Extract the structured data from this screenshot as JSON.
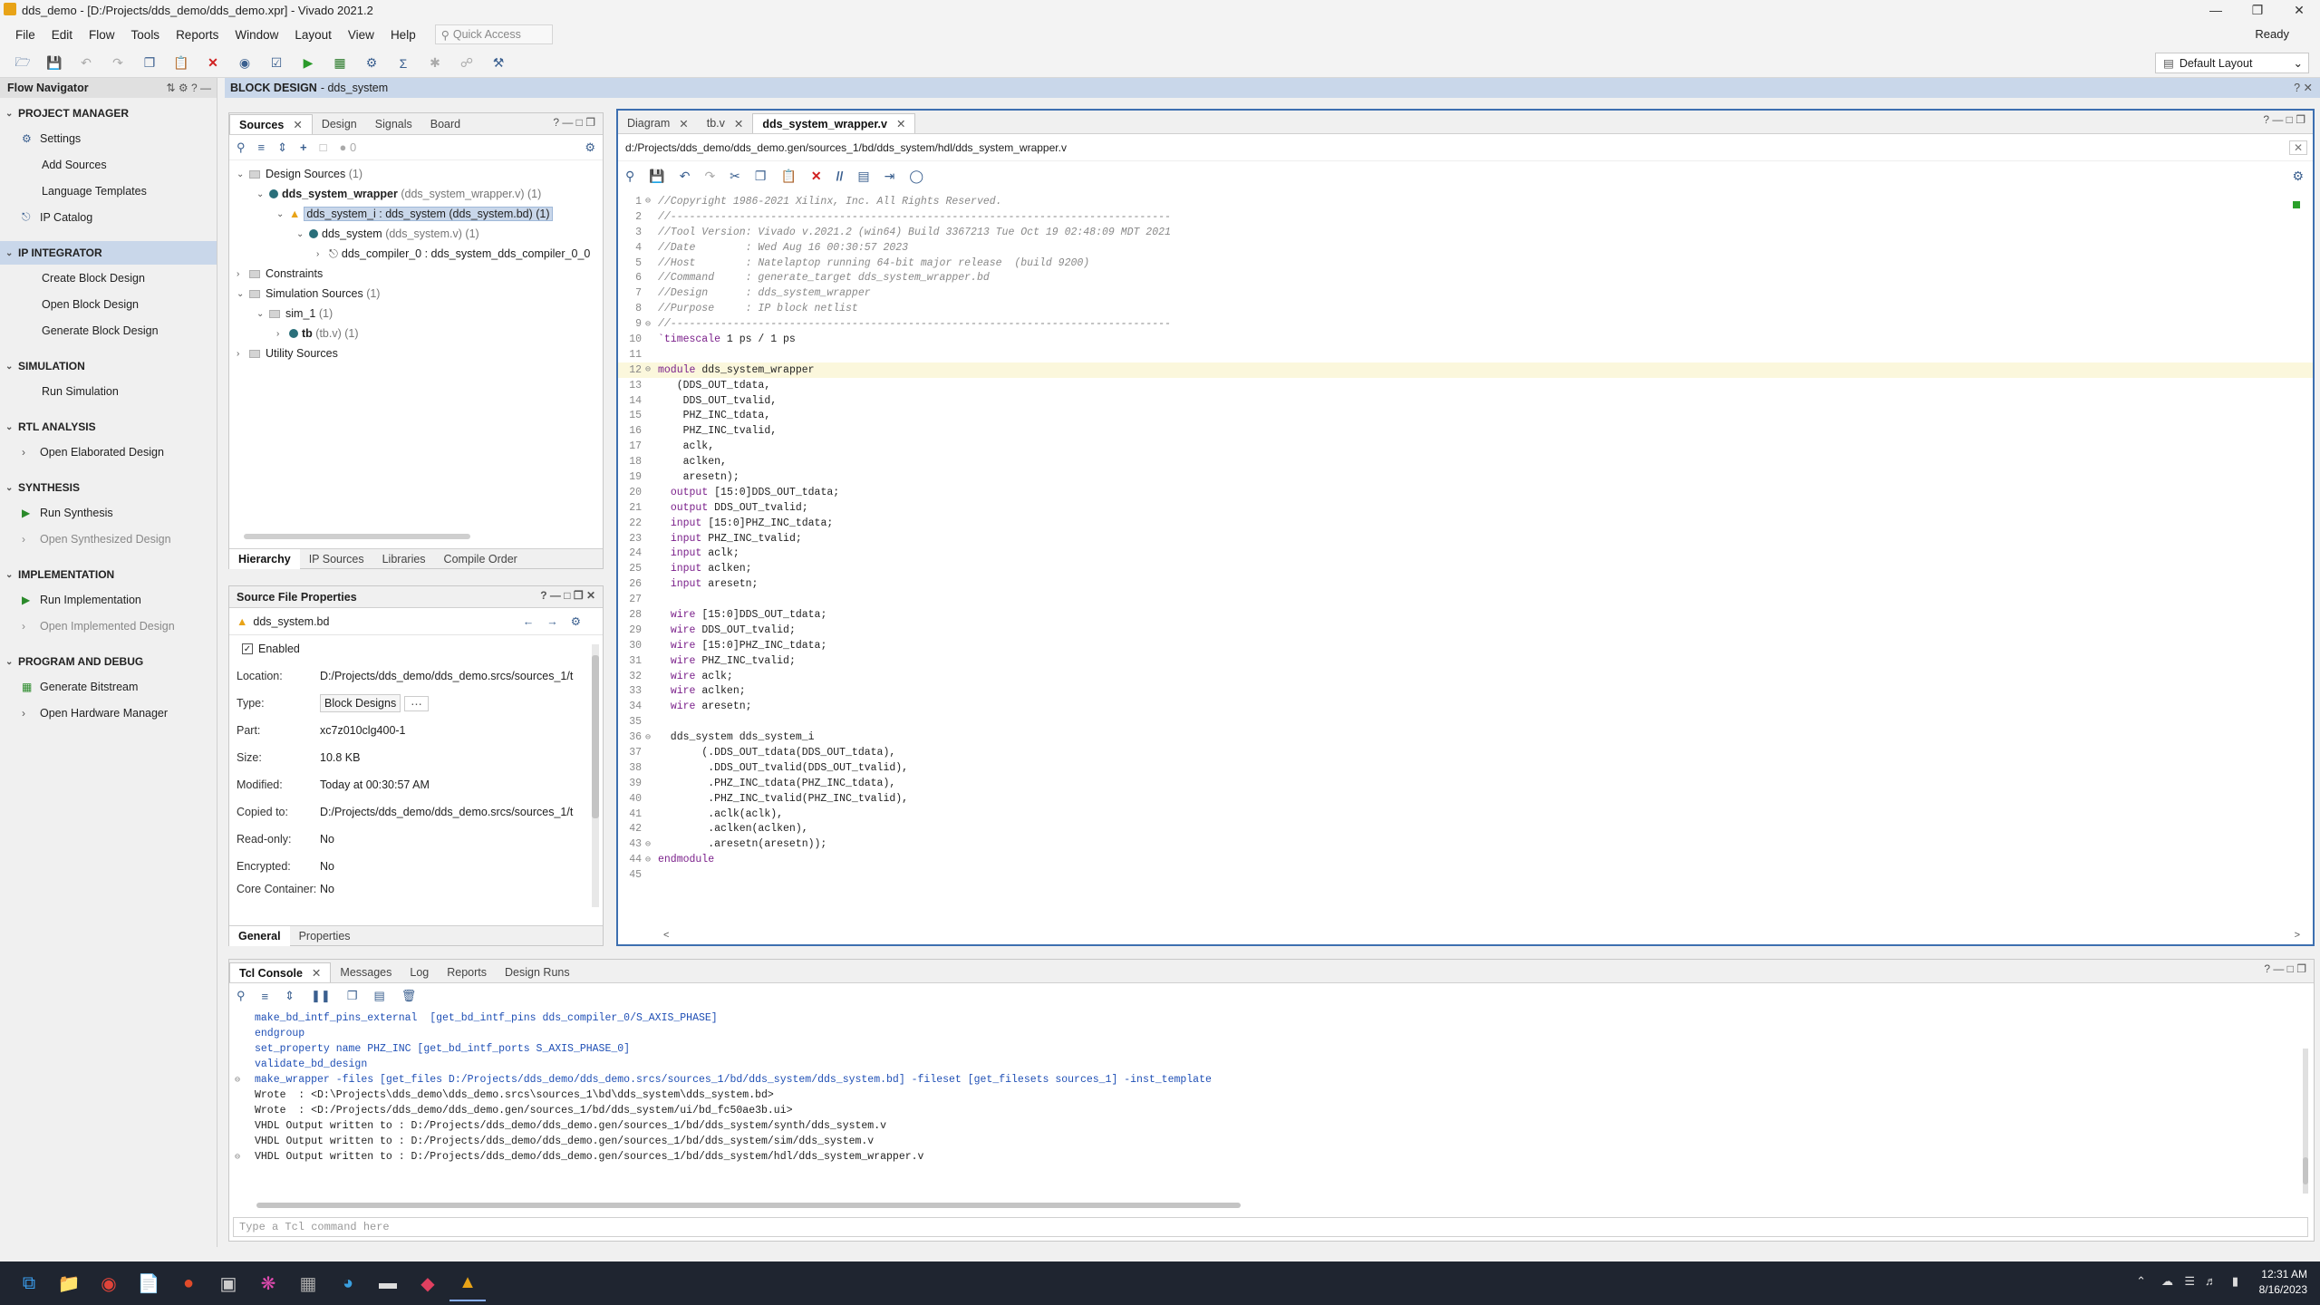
{
  "titlebar": {
    "title": "dds_demo - [D:/Projects/dds_demo/dds_demo.xpr] - Vivado 2021.2"
  },
  "menu": {
    "items": [
      "File",
      "Edit",
      "Flow",
      "Tools",
      "Reports",
      "Window",
      "Layout",
      "View",
      "Help"
    ],
    "quick_access": "Quick Access",
    "status": "Ready"
  },
  "toolbar": {
    "layout": "Default Layout"
  },
  "flownav": {
    "title": "Flow Navigator",
    "sections": [
      {
        "label": "PROJECT MANAGER",
        "items": [
          "Settings",
          "Add Sources",
          "Language Templates",
          "IP Catalog"
        ]
      },
      {
        "label": "IP INTEGRATOR",
        "items": [
          "Create Block Design",
          "Open Block Design",
          "Generate Block Design"
        ]
      },
      {
        "label": "SIMULATION",
        "items": [
          "Run Simulation"
        ]
      },
      {
        "label": "RTL ANALYSIS",
        "items": [
          "Open Elaborated Design"
        ]
      },
      {
        "label": "SYNTHESIS",
        "items": [
          "Run Synthesis",
          "Open Synthesized Design"
        ]
      },
      {
        "label": "IMPLEMENTATION",
        "items": [
          "Run Implementation",
          "Open Implemented Design"
        ]
      },
      {
        "label": "PROGRAM AND DEBUG",
        "items": [
          "Generate Bitstream",
          "Open Hardware Manager"
        ]
      }
    ]
  },
  "bd": {
    "label": "BLOCK DESIGN",
    "name": "- dds_system"
  },
  "sources": {
    "tabs": [
      "Sources",
      "Design",
      "Signals",
      "Board"
    ],
    "count": "0",
    "tree": [
      {
        "t": "Design Sources",
        "g": "(1)"
      },
      {
        "t": "dds_system_wrapper",
        "g": "(dds_system_wrapper.v) (1)"
      },
      {
        "t": "dds_system_i : dds_system (dds_system.bd) (1)",
        "g": ""
      },
      {
        "t": "dds_system",
        "g": "(dds_system.v) (1)"
      },
      {
        "t": "dds_compiler_0 : dds_system_dds_compiler_0_0",
        "g": ""
      },
      {
        "t": "Constraints",
        "g": ""
      },
      {
        "t": "Simulation Sources",
        "g": "(1)"
      },
      {
        "t": "sim_1",
        "g": "(1)"
      },
      {
        "t": "tb",
        "g": "(tb.v) (1)"
      },
      {
        "t": "Utility Sources",
        "g": ""
      }
    ],
    "bottom_tabs": [
      "Hierarchy",
      "IP Sources",
      "Libraries",
      "Compile Order"
    ]
  },
  "props": {
    "title": "Source File Properties",
    "file": "dds_system.bd",
    "enabled": "Enabled",
    "rows": [
      {
        "k": "Location:",
        "v": "D:/Projects/dds_demo/dds_demo.srcs/sources_1/t"
      },
      {
        "k": "Type:",
        "v": "Block Designs"
      },
      {
        "k": "Part:",
        "v": "xc7z010clg400-1"
      },
      {
        "k": "Size:",
        "v": "10.8 KB"
      },
      {
        "k": "Modified:",
        "v": "Today at 00:30:57 AM"
      },
      {
        "k": "Copied to:",
        "v": "D:/Projects/dds_demo/dds_demo.srcs/sources_1/t"
      },
      {
        "k": "Read-only:",
        "v": "No"
      },
      {
        "k": "Encrypted:",
        "v": "No"
      },
      {
        "k": "Core Container:",
        "v": "No"
      }
    ],
    "bottom_tabs": [
      "General",
      "Properties"
    ]
  },
  "editor": {
    "tabs": [
      "Diagram",
      "tb.v",
      "dds_system_wrapper.v"
    ],
    "path": "d:/Projects/dds_demo/dds_demo.gen/sources_1/bd/dds_system/hdl/dds_system_wrapper.v",
    "lines": [
      "//Copyright 1986-2021 Xilinx, Inc. All Rights Reserved.",
      "//--------------------------------------------------------------------------------",
      "//Tool Version: Vivado v.2021.2 (win64) Build 3367213 Tue Oct 19 02:48:09 MDT 2021",
      "//Date        : Wed Aug 16 00:30:57 2023",
      "//Host        : Natelaptop running 64-bit major release  (build 9200)",
      "//Command     : generate_target dds_system_wrapper.bd",
      "//Design      : dds_system_wrapper",
      "//Purpose     : IP block netlist",
      "//--------------------------------------------------------------------------------",
      "`timescale 1 ps / 1 ps",
      "",
      "module dds_system_wrapper",
      "   (DDS_OUT_tdata,",
      "    DDS_OUT_tvalid,",
      "    PHZ_INC_tdata,",
      "    PHZ_INC_tvalid,",
      "    aclk,",
      "    aclken,",
      "    aresetn);",
      "  output [15:0]DDS_OUT_tdata;",
      "  output DDS_OUT_tvalid;",
      "  input [15:0]PHZ_INC_tdata;",
      "  input PHZ_INC_tvalid;",
      "  input aclk;",
      "  input aclken;",
      "  input aresetn;",
      "",
      "  wire [15:0]DDS_OUT_tdata;",
      "  wire DDS_OUT_tvalid;",
      "  wire [15:0]PHZ_INC_tdata;",
      "  wire PHZ_INC_tvalid;",
      "  wire aclk;",
      "  wire aclken;",
      "  wire aresetn;",
      "",
      "  dds_system dds_system_i",
      "       (.DDS_OUT_tdata(DDS_OUT_tdata),",
      "        .DDS_OUT_tvalid(DDS_OUT_tvalid),",
      "        .PHZ_INC_tdata(PHZ_INC_tdata),",
      "        .PHZ_INC_tvalid(PHZ_INC_tvalid),",
      "        .aclk(aclk),",
      "        .aclken(aclken),",
      "        .aresetn(aresetn));",
      "endmodule",
      ""
    ]
  },
  "console": {
    "tabs": [
      "Tcl Console",
      "Messages",
      "Log",
      "Reports",
      "Design Runs"
    ],
    "lines": [
      "make_bd_intf_pins_external  [get_bd_intf_pins dds_compiler_0/S_AXIS_PHASE]",
      "endgroup",
      "set_property name PHZ_INC [get_bd_intf_ports S_AXIS_PHASE_0]",
      "validate_bd_design",
      "make_wrapper -files [get_files D:/Projects/dds_demo/dds_demo.srcs/sources_1/bd/dds_system/dds_system.bd] -fileset [get_filesets sources_1] -inst_template",
      "Wrote  : <D:\\Projects\\dds_demo\\dds_demo.srcs\\sources_1\\bd\\dds_system\\dds_system.bd>",
      "Wrote  : <D:/Projects/dds_demo/dds_demo.gen/sources_1/bd/dds_system/ui/bd_fc50ae3b.ui>",
      "VHDL Output written to : D:/Projects/dds_demo/dds_demo.gen/sources_1/bd/dds_system/synth/dds_system.v",
      "VHDL Output written to : D:/Projects/dds_demo/dds_demo.gen/sources_1/bd/dds_system/sim/dds_system.v",
      "VHDL Output written to : D:/Projects/dds_demo/dds_demo.gen/sources_1/bd/dds_system/hdl/dds_system_wrapper.v"
    ],
    "placeholder": "Type a Tcl command here"
  },
  "taskbar": {
    "time": "12:31 AM",
    "date": "8/16/2023"
  }
}
